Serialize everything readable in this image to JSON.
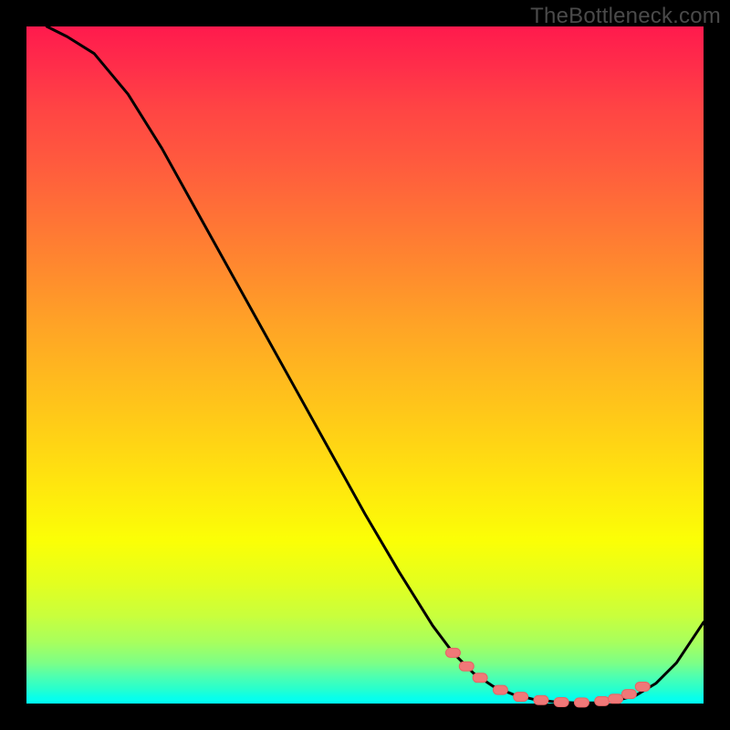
{
  "watermark": "TheBottleneck.com",
  "colors": {
    "curve": "#000000",
    "marker_fill": "#f07878",
    "marker_stroke": "#e56464",
    "background": "#000000"
  },
  "chart_data": {
    "type": "line",
    "title": "",
    "xlabel": "",
    "ylabel": "",
    "xlim": [
      0,
      100
    ],
    "ylim": [
      0,
      100
    ],
    "grid": false,
    "legend": false,
    "annotations": [],
    "series": [
      {
        "name": "curve",
        "x": [
          3,
          6,
          10,
          15,
          20,
          25,
          30,
          35,
          40,
          45,
          50,
          55,
          60,
          63,
          66,
          69,
          72,
          75,
          78,
          81,
          84,
          87,
          90,
          93,
          96,
          100
        ],
        "values": [
          100,
          98.5,
          96,
          90,
          82,
          73,
          64,
          55,
          46,
          37,
          28,
          19.5,
          11.5,
          7.5,
          4.5,
          2.5,
          1.3,
          0.6,
          0.25,
          0.1,
          0.1,
          0.4,
          1.2,
          3.0,
          6.0,
          12.0
        ]
      }
    ],
    "markers": {
      "name": "highlight-points",
      "x": [
        63,
        65,
        67,
        70,
        73,
        76,
        79,
        82,
        85,
        87,
        89,
        91
      ],
      "values": [
        7.5,
        5.5,
        3.8,
        2.0,
        1.0,
        0.5,
        0.2,
        0.15,
        0.35,
        0.7,
        1.4,
        2.5
      ]
    }
  }
}
